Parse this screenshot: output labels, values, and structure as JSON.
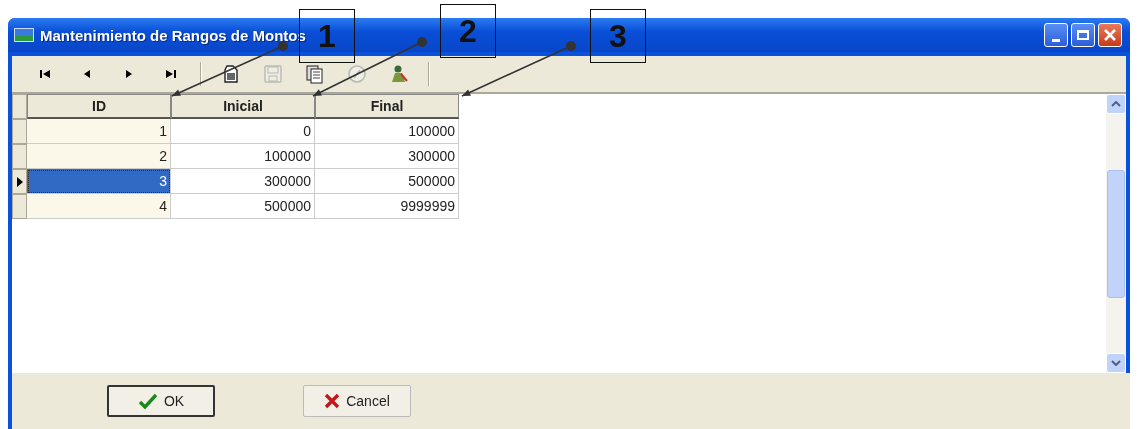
{
  "window": {
    "title": "Mantenimiento de Rangos de Montos"
  },
  "toolbar": [
    {
      "kind": "first",
      "disabled": false
    },
    {
      "kind": "prev",
      "disabled": false
    },
    {
      "kind": "next",
      "disabled": false
    },
    {
      "kind": "last",
      "disabled": false
    },
    {
      "kind": "new",
      "disabled": false
    },
    {
      "kind": "save",
      "disabled": true
    },
    {
      "kind": "delete",
      "disabled": false
    },
    {
      "kind": "undo",
      "disabled": true
    },
    {
      "kind": "exit",
      "disabled": false
    }
  ],
  "table": {
    "columns": [
      "ID",
      "Inicial",
      "Final"
    ],
    "rows": [
      {
        "cells": [
          "1",
          "0",
          "100000"
        ],
        "selected": false
      },
      {
        "cells": [
          "2",
          "100000",
          "300000"
        ],
        "selected": false
      },
      {
        "cells": [
          "3",
          "300000",
          "500000"
        ],
        "selected": true
      },
      {
        "cells": [
          "4",
          "500000",
          "9999999"
        ],
        "selected": false
      }
    ]
  },
  "buttons": [
    {
      "kind": "ok",
      "label": "OK"
    },
    {
      "kind": "cancel",
      "label": "Cancel"
    }
  ],
  "callouts": [
    {
      "label": "1"
    },
    {
      "label": "2"
    },
    {
      "label": "3"
    }
  ]
}
